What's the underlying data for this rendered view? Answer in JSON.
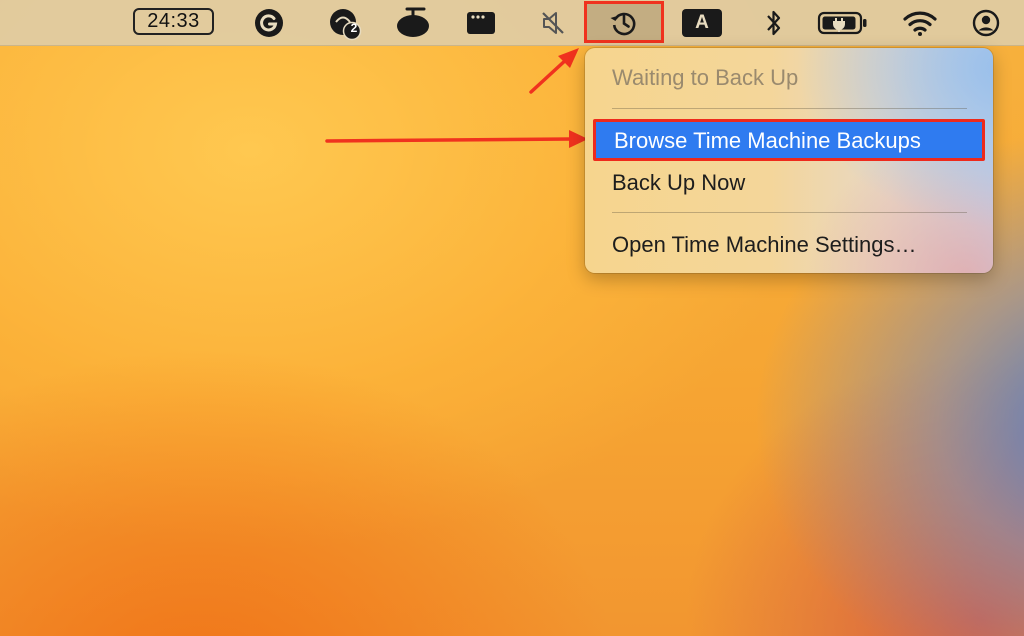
{
  "menubar": {
    "clock_text": "24:33",
    "badge_count": "2",
    "input_source_letter": "A",
    "icons": [
      "grammarly-icon",
      "notification-app-icon",
      "bowl-app-icon",
      "window-app-icon",
      "mute-icon",
      "time-machine-icon",
      "input-source-icon",
      "bluetooth-icon",
      "battery-charging-icon",
      "wifi-icon",
      "user-account-icon"
    ]
  },
  "menu": {
    "status": "Waiting to Back Up",
    "items": [
      {
        "label": "Browse Time Machine Backups",
        "selected": true
      },
      {
        "label": "Back Up Now",
        "selected": false
      },
      {
        "label": "Open Time Machine Settings…",
        "selected": false
      }
    ]
  },
  "annotations": {
    "highlight_color": "#f0321e",
    "selection_color": "#2f7bf0"
  }
}
